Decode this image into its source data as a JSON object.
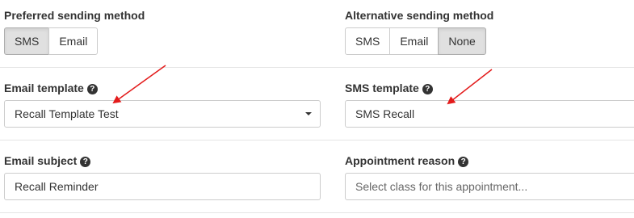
{
  "preferred": {
    "label": "Preferred sending method",
    "options": [
      "SMS",
      "Email"
    ],
    "selected": "SMS"
  },
  "alternative": {
    "label": "Alternative sending method",
    "options": [
      "SMS",
      "Email",
      "None"
    ],
    "selected": "None"
  },
  "email_template": {
    "label": "Email template",
    "value": "Recall Template Test"
  },
  "sms_template": {
    "label": "SMS template",
    "value": "SMS Recall"
  },
  "email_subject": {
    "label": "Email subject",
    "value": "Recall Reminder"
  },
  "appointment_reason": {
    "label": "Appointment reason",
    "placeholder": "Select class for this appointment..."
  },
  "help_glyph": "?",
  "icons": {
    "help": "question-circle-icon",
    "caret": "caret-down-icon"
  },
  "annotation_color": "#e31b1b"
}
